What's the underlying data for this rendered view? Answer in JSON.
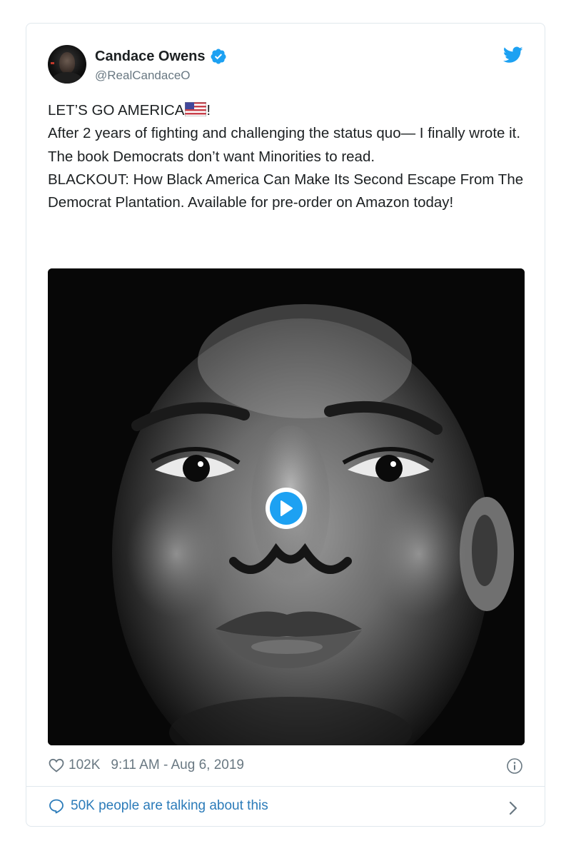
{
  "tweet": {
    "author": {
      "display_name": "Candace Owens",
      "handle": "@RealCandaceO",
      "verified": true,
      "avatar_icon": "profile-photo"
    },
    "brand_icon": "twitter-bird-icon",
    "text": {
      "line1": "LET’S GO AMERICA",
      "line1_suffix": "!",
      "body": "After 2 years of fighting and challenging the status quo— I finally wrote it.\nThe book Democrats don’t want Minorities to read.\nBLACKOUT: How Black America Can Make Its Second Escape From The Democrat Plantation. Available for pre-order on Amazon today!",
      "emoji": "us-flag"
    },
    "media": {
      "type": "video",
      "play_icon": "play-icon",
      "description_colors": {
        "background": "#070707",
        "play": "#1da1f2"
      }
    },
    "likes": "102K",
    "timestamp": "9:11 AM - Aug 6, 2019",
    "info_icon": "info-icon",
    "conversation": {
      "label": "50K people are talking about this",
      "icon": "speech-bubble-icon"
    }
  },
  "colors": {
    "accent": "#1da1f2",
    "link": "#2b7bb9",
    "muted": "#697882",
    "border": "#e1e8ed",
    "text": "#1c2022"
  }
}
